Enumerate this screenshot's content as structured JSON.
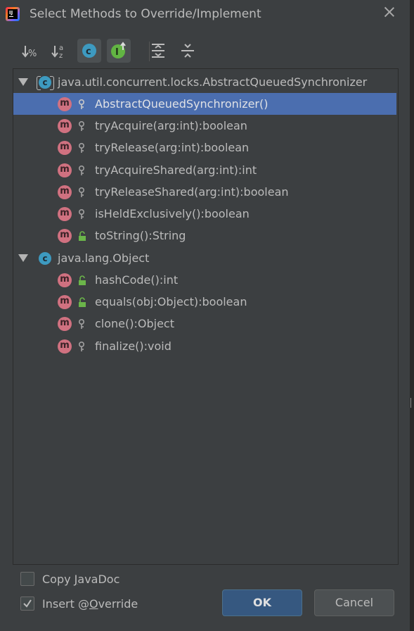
{
  "window": {
    "title": "Select Methods to Override/Implement"
  },
  "toolbar": {
    "buttons": [
      {
        "icon": "sort-by-visibility-icon",
        "active": false
      },
      {
        "icon": "sort-alphabetically-icon",
        "active": false
      },
      {
        "icon": "show-classes-icon",
        "active": true
      },
      {
        "icon": "show-interfaces-icon",
        "active": true
      },
      {
        "icon": "expand-all-icon",
        "active": false
      },
      {
        "icon": "collapse-all-icon",
        "active": false
      }
    ]
  },
  "tree": {
    "groups": [
      {
        "class_name": "java.util.concurrent.locks.AbstractQueuedSynchronizer",
        "class_icon": "c",
        "methods": [
          {
            "icon": "m",
            "visibility": "protected",
            "label": "AbstractQueuedSynchronizer()",
            "selected": true
          },
          {
            "icon": "m",
            "visibility": "protected",
            "label": "tryAcquire(arg:int):boolean",
            "selected": false
          },
          {
            "icon": "m",
            "visibility": "protected",
            "label": "tryRelease(arg:int):boolean",
            "selected": false
          },
          {
            "icon": "m",
            "visibility": "protected",
            "label": "tryAcquireShared(arg:int):int",
            "selected": false
          },
          {
            "icon": "m",
            "visibility": "protected",
            "label": "tryReleaseShared(arg:int):boolean",
            "selected": false
          },
          {
            "icon": "m",
            "visibility": "protected",
            "label": "isHeldExclusively():boolean",
            "selected": false
          },
          {
            "icon": "m",
            "visibility": "public",
            "label": "toString():String",
            "selected": false
          }
        ]
      },
      {
        "class_name": "java.lang.Object",
        "class_icon": "c",
        "methods": [
          {
            "icon": "m",
            "visibility": "public",
            "label": "hashCode():int",
            "selected": false
          },
          {
            "icon": "m",
            "visibility": "public",
            "label": "equals(obj:Object):boolean",
            "selected": false
          },
          {
            "icon": "m",
            "visibility": "protected",
            "label": "clone():Object",
            "selected": false
          },
          {
            "icon": "m",
            "visibility": "protected",
            "label": "finalize():void",
            "selected": false
          }
        ]
      }
    ]
  },
  "options": {
    "copy_javadoc": {
      "pre": "Copy ",
      "mnemonic": "J",
      "post": "avaDoc",
      "checked": false
    },
    "insert_override": {
      "pre": "Insert @",
      "mnemonic": "O",
      "post": "verride",
      "checked": true
    }
  },
  "buttons": {
    "ok": "OK",
    "cancel": "Cancel"
  },
  "colors": {
    "background": "#3c3f41",
    "selection": "#4b6eaf",
    "method_icon": "#d07180",
    "class_icon": "#3d9ac0",
    "ok_button": "#365880"
  }
}
